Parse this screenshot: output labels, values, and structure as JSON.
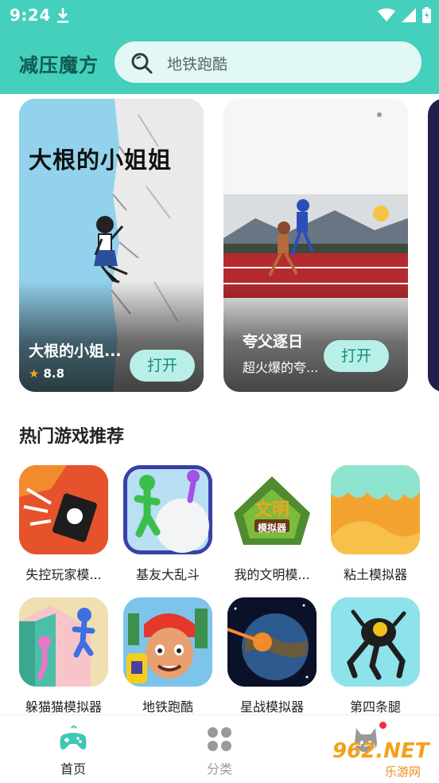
{
  "status_bar": {
    "time": "9:24"
  },
  "app_bar": {
    "title": "减压魔方",
    "search_placeholder": "地铁跑酷"
  },
  "banner": {
    "cards": [
      {
        "poster_text": "大根的小姐姐",
        "title": "大根的小姐...",
        "rating": "8.8",
        "button": "打开"
      },
      {
        "title": "夸父逐日",
        "subtitle": "超火爆的夸...",
        "button": "打开"
      }
    ]
  },
  "section": {
    "title": "热门游戏推荐",
    "games": [
      {
        "label": "失控玩家模...",
        "icon": "explosion-icon"
      },
      {
        "label": "基友大乱斗",
        "icon": "snowball-icon"
      },
      {
        "label": "我的文明模...",
        "icon": "civilization-icon",
        "icon_text_top": "文明",
        "icon_text_bottom": "模拟器"
      },
      {
        "label": "粘土模拟器",
        "icon": "slime-icon"
      },
      {
        "label": "躲猫猫模拟器",
        "icon": "hide-seek-icon"
      },
      {
        "label": "地铁跑酷",
        "icon": "subway-surfer-icon"
      },
      {
        "label": "星战模拟器",
        "icon": "planet-icon"
      },
      {
        "label": "第四条腿",
        "icon": "robot-bug-icon"
      }
    ]
  },
  "bottom_nav": {
    "items": [
      {
        "label": "首页",
        "icon": "gamepad-icon",
        "active": true
      },
      {
        "label": "分类",
        "icon": "grid-icon",
        "active": false
      },
      {
        "label": "",
        "icon": "cat-icon",
        "active": false
      }
    ]
  },
  "watermark": {
    "text": "962.NET",
    "subtext": "乐游网"
  },
  "colors": {
    "accent": "#45cfbd",
    "title": "#0f5a52",
    "button_bg": "#b8f0e8",
    "button_text": "#1a8a7c"
  }
}
